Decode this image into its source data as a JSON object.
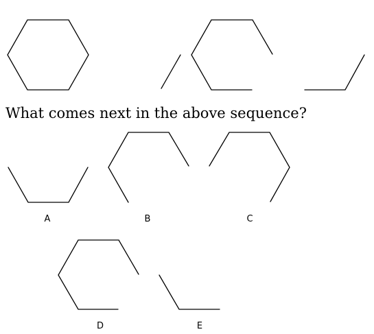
{
  "question": {
    "text": "What comes next in the above sequence?"
  },
  "sequence": [
    {
      "id": "figure-1",
      "shape": "hexagon-full"
    },
    {
      "id": "figure-2",
      "shape": "hexagon-partial"
    },
    {
      "id": "figure-3",
      "shape": "hexagon-partial"
    }
  ],
  "options": [
    {
      "label": "A"
    },
    {
      "label": "B"
    },
    {
      "label": "C"
    },
    {
      "label": "D"
    },
    {
      "label": "E"
    }
  ]
}
